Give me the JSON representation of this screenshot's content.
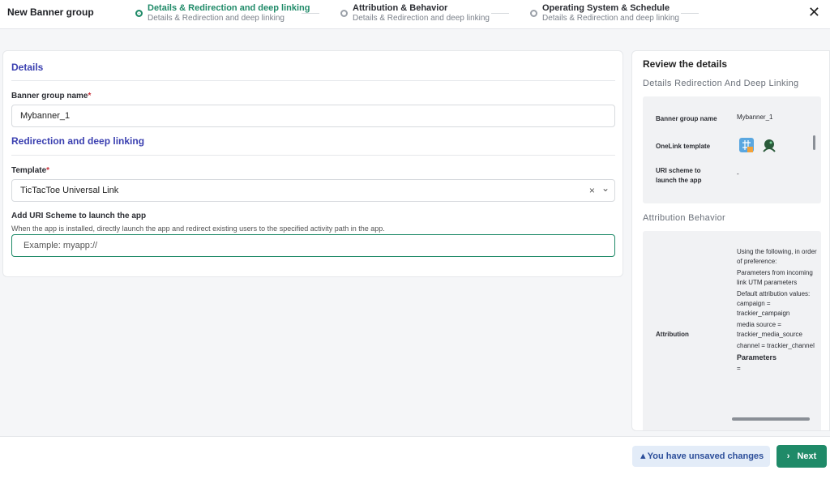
{
  "app_title": "New Banner group",
  "steps": [
    {
      "title": "Details & Redirection and deep linking",
      "subtitle": "Details & Redirection and deep linking"
    },
    {
      "title": "Attribution & Behavior",
      "subtitle": "Details & Redirection and deep linking"
    },
    {
      "title": "Operating System & Schedule",
      "subtitle": "Details & Redirection and deep linking"
    }
  ],
  "close_icon": "close-icon",
  "form": {
    "details_title": "Details",
    "name_label": "Banner group name",
    "required_mark": "*",
    "name_value": "Mybanner_1",
    "redirect_title": "Redirection and deep linking",
    "template_label": "Template",
    "template_value": "TicTacToe Universal Link",
    "uri_label": "Add URI Scheme to launch the app",
    "uri_help": "When the app is installed, directly launch the app and redirect existing users to the specified activity path in the app.",
    "uri_placeholder": "Example: myapp://",
    "clear_glyph": "×",
    "chevron_glyph": "⌄"
  },
  "review": {
    "title": "Review the details",
    "section1": "Details Redirection And Deep Linking",
    "rows": [
      {
        "key": "Banner group name",
        "value": "Mybanner_1"
      },
      {
        "key": "OneLink template",
        "value": ""
      },
      {
        "key": "URI scheme to launch the app",
        "value": "-"
      }
    ],
    "section2": "Attribution Behavior",
    "attribution_key": "Attribution",
    "attribution_lines": [
      "Using the following, in order of preference:",
      "Parameters from incoming link UTM parameters",
      "Default attribution values: campaign = trackier_campaign",
      "media source = trackier_media_source",
      "channel = trackier_channel"
    ],
    "attribution_bold": "Parameters",
    "attribution_tail": "="
  },
  "footer": {
    "unsaved_label": "▲You have unsaved changes",
    "next_label": "Next",
    "next_glyph": "›"
  },
  "colors": {
    "accent": "#1f8a68",
    "section_title": "#3a3fb0",
    "unsaved_bg": "#e3ecf8"
  }
}
